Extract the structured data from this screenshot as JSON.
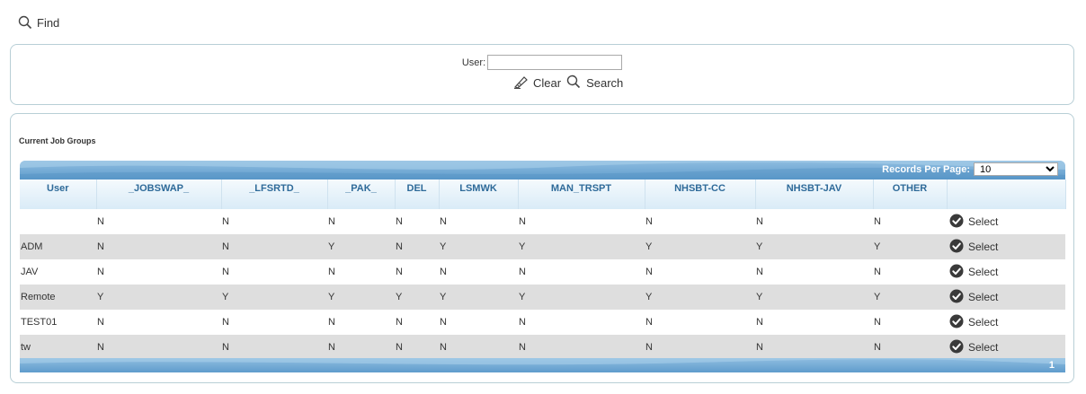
{
  "find": {
    "label": "Find",
    "icon": "magnifier-icon"
  },
  "search_form": {
    "user_label": "User:",
    "user_value": "",
    "clear_label": "Clear",
    "search_label": "Search"
  },
  "grid": {
    "caption": "Current Job Groups",
    "records_per_page_label": "Records Per Page:",
    "records_per_page_value": "10",
    "columns": [
      "User",
      "_JOBSWAP_",
      "_LFSRTD_",
      "_PAK_",
      "DEL",
      "LSMWK",
      "MAN_TRSPT",
      "NHSBT-CC",
      "NHSBT-JAV",
      "OTHER",
      ""
    ],
    "rows": [
      [
        "",
        "N",
        "N",
        "N",
        "N",
        "N",
        "N",
        "N",
        "N",
        "N"
      ],
      [
        "ADM",
        "N",
        "N",
        "Y",
        "N",
        "Y",
        "Y",
        "Y",
        "Y",
        "Y"
      ],
      [
        "JAV",
        "N",
        "N",
        "N",
        "N",
        "N",
        "N",
        "N",
        "N",
        "N"
      ],
      [
        "Remote",
        "Y",
        "Y",
        "Y",
        "Y",
        "Y",
        "Y",
        "Y",
        "Y",
        "Y"
      ],
      [
        "TEST01",
        "N",
        "N",
        "N",
        "N",
        "N",
        "N",
        "N",
        "N",
        "N"
      ],
      [
        "tw",
        "N",
        "N",
        "N",
        "N",
        "N",
        "N",
        "N",
        "N",
        "N"
      ]
    ],
    "row_action_label": "Select",
    "page": "1"
  },
  "colors": {
    "header_blue": "#5f9ccc",
    "header_text": "#2e6a99",
    "alt_row": "#dedede",
    "border": "#b8cfd6"
  }
}
